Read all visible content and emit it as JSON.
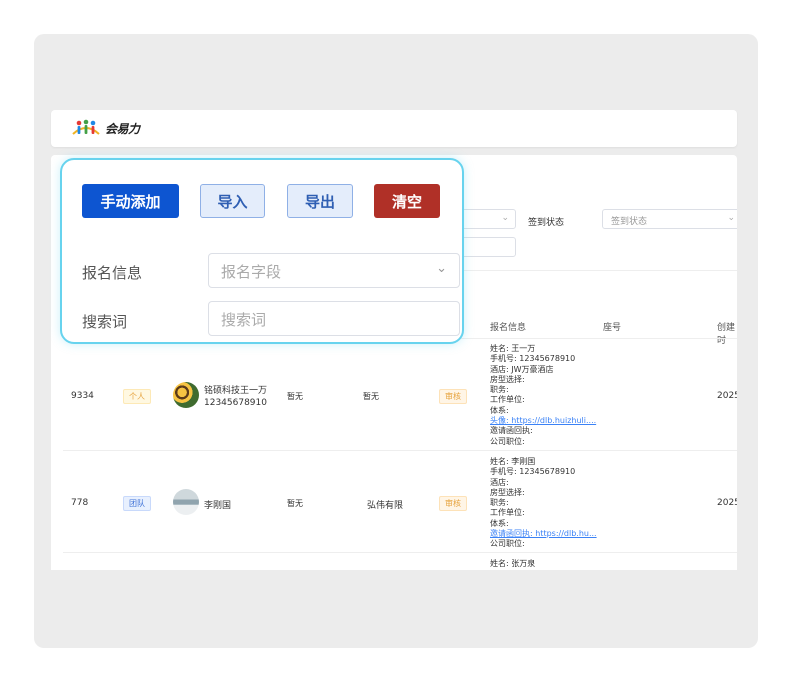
{
  "app": {
    "logo_text": "会易力"
  },
  "filters": {
    "signin_label": "签到状态",
    "signin_placeholder": "签到状态"
  },
  "table": {
    "headers": {
      "info": "报名信息",
      "seat": "座号",
      "created": "创建时"
    },
    "rows": [
      {
        "id": "9334",
        "type": "个人",
        "name": "铭硕科技王一万",
        "phone": "12345678910",
        "col_a": "暂无",
        "col_b": "暂无",
        "status": "审核",
        "info": [
          "姓名: 王一万",
          "手机号: 12345678910",
          "酒店: JW万豪酒店",
          "房型选择:",
          "职务:",
          "工作单位:",
          "体系:"
        ],
        "info_link": "头像: https://dlb.huizhuli....",
        "info_tail": [
          "邀请函回执:",
          "公司职位:"
        ],
        "created": "2025"
      },
      {
        "id": "778",
        "type": "团队",
        "name": "李刚国",
        "phone": "",
        "col_a": "暂无",
        "col_b": "弘伟有限",
        "status": "审核",
        "info": [
          "姓名: 李刚国",
          "手机号: 12345678910",
          "酒店:",
          "房型选择:",
          "职务:",
          "工作单位:",
          "体系:"
        ],
        "info_link": "邀请函回执: https://dlb.hu...",
        "info_tail": [
          "公司职位:"
        ],
        "created": "2025"
      },
      {
        "info": [
          "姓名: 张万泉"
        ]
      }
    ]
  },
  "popup": {
    "add_label": "手动添加",
    "import_label": "导入",
    "export_label": "导出",
    "clear_label": "清空",
    "signup_info_label": "报名信息",
    "signup_field_placeholder": "报名字段",
    "search_label": "搜索词",
    "search_placeholder": "搜索词"
  },
  "colors": {
    "primary": "#0d55d1",
    "danger": "#b03027",
    "highlight": "#67d3ee"
  }
}
